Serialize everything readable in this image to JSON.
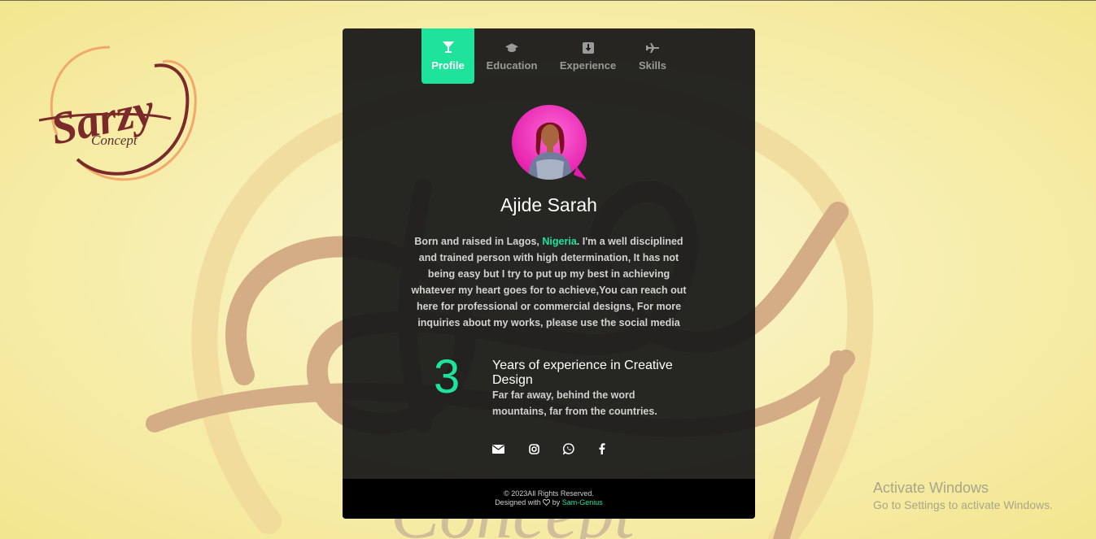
{
  "brand": {
    "logo_script": "Sarzy",
    "logo_sub": "Concept"
  },
  "colors": {
    "accent": "#1de39b",
    "card_bg": "#1a1a1a",
    "logo_red": "#7a2a2a",
    "logo_orange": "#f2a86b"
  },
  "tabs": [
    {
      "label": "Profile",
      "icon": "glass-icon",
      "active": true
    },
    {
      "label": "Education",
      "icon": "graduation-cap-icon",
      "active": false
    },
    {
      "label": "Experience",
      "icon": "download-icon",
      "active": false
    },
    {
      "label": "Skills",
      "icon": "plane-icon",
      "active": false
    }
  ],
  "profile": {
    "name": "Ajide Sarah",
    "bio_before": "Born and raised in Lagos, ",
    "bio_highlight": "Nigeria",
    "bio_after": ". I'm a well disciplined and trained person with high determination, It has not being easy but I try to put up my best in achieving whatever my heart goes for to achieve,You can reach out here for professional or commercial designs, For more inquiries about my works, please use the social media"
  },
  "experience": {
    "years": "3",
    "title": "Years of experience in Creative Design",
    "description": "Far far away, behind the word mountains, far from the countries."
  },
  "social": [
    {
      "icon": "envelope-icon"
    },
    {
      "icon": "instagram-icon"
    },
    {
      "icon": "whatsapp-icon"
    },
    {
      "icon": "facebook-icon"
    }
  ],
  "footer": {
    "copyright": "© 2023All Rights Reserved.",
    "designed_with": "Designed with",
    "by": "by",
    "author": "Sam-Genius"
  },
  "os_watermark": {
    "title": "Activate Windows",
    "subtitle": "Go to Settings to activate Windows."
  }
}
